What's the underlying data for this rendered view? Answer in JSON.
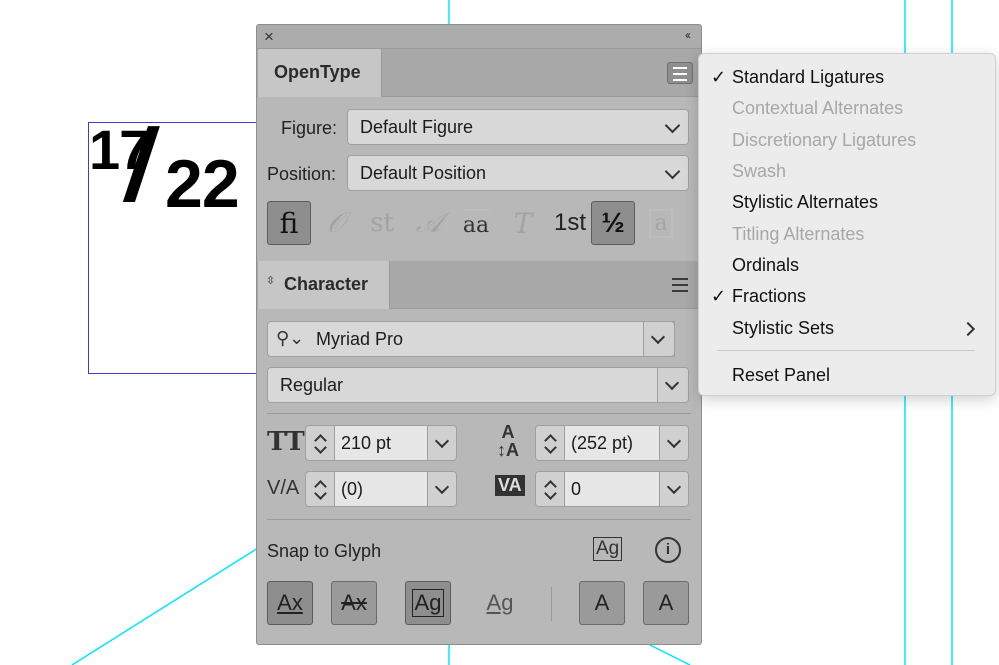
{
  "canvas": {
    "fraction": {
      "numerator": "17",
      "slash": "/",
      "denominator": "22"
    },
    "guide_color": "#00e5ff",
    "frame_color": "#3b3bd9"
  },
  "opentype_panel": {
    "close_icon": "×",
    "collapse_icon": "‹‹",
    "tab_label": "OpenType",
    "figure_label": "Figure:",
    "figure_value": "Default Figure",
    "position_label": "Position:",
    "position_value": "Default Position",
    "glyph_buttons": [
      {
        "icon": "ligature-icon",
        "glyph": "ﬁ",
        "active": true
      },
      {
        "icon": "contextual-alternates-icon",
        "glyph": "𝒪",
        "active": false
      },
      {
        "icon": "discretionary-ligature-icon",
        "glyph": "st",
        "active": false
      },
      {
        "icon": "swash-icon",
        "glyph": "𝒜",
        "active": false
      },
      {
        "icon": "stylistic-alternates-icon",
        "glyph": "aa",
        "active": false
      },
      {
        "icon": "titling-alternates-icon",
        "glyph": "T",
        "active": false
      },
      {
        "icon": "ordinals-icon",
        "glyph": "1st",
        "active": false
      },
      {
        "icon": "fractions-icon",
        "glyph": "½",
        "active": true
      },
      {
        "icon": "stylistic-sets-icon",
        "glyph": "a",
        "active": false
      }
    ]
  },
  "character_panel": {
    "tab_label": "Character",
    "font_family": "Myriad Pro",
    "font_style": "Regular",
    "font_size": "210 pt",
    "leading": "(252 pt)",
    "kerning": "(0)",
    "tracking": "0",
    "snap_label": "Snap to Glyph",
    "snap_icons": [
      "glyph-bounds-icon",
      "info-icon"
    ],
    "snap_buttons": [
      "Ax",
      "Ax",
      "Ag",
      "Ag",
      "A",
      "A"
    ]
  },
  "flyout_menu": {
    "items": [
      {
        "label": "Standard Ligatures",
        "checked": true,
        "disabled": false
      },
      {
        "label": "Contextual Alternates",
        "checked": false,
        "disabled": true
      },
      {
        "label": "Discretionary Ligatures",
        "checked": false,
        "disabled": true
      },
      {
        "label": "Swash",
        "checked": false,
        "disabled": true
      },
      {
        "label": "Stylistic Alternates",
        "checked": false,
        "disabled": false
      },
      {
        "label": "Titling Alternates",
        "checked": false,
        "disabled": true
      },
      {
        "label": "Ordinals",
        "checked": false,
        "disabled": false
      },
      {
        "label": "Fractions",
        "checked": true,
        "disabled": false
      },
      {
        "label": "Stylistic Sets",
        "checked": false,
        "disabled": false,
        "submenu": true
      }
    ],
    "reset_label": "Reset Panel",
    "check_glyph": "✓"
  }
}
